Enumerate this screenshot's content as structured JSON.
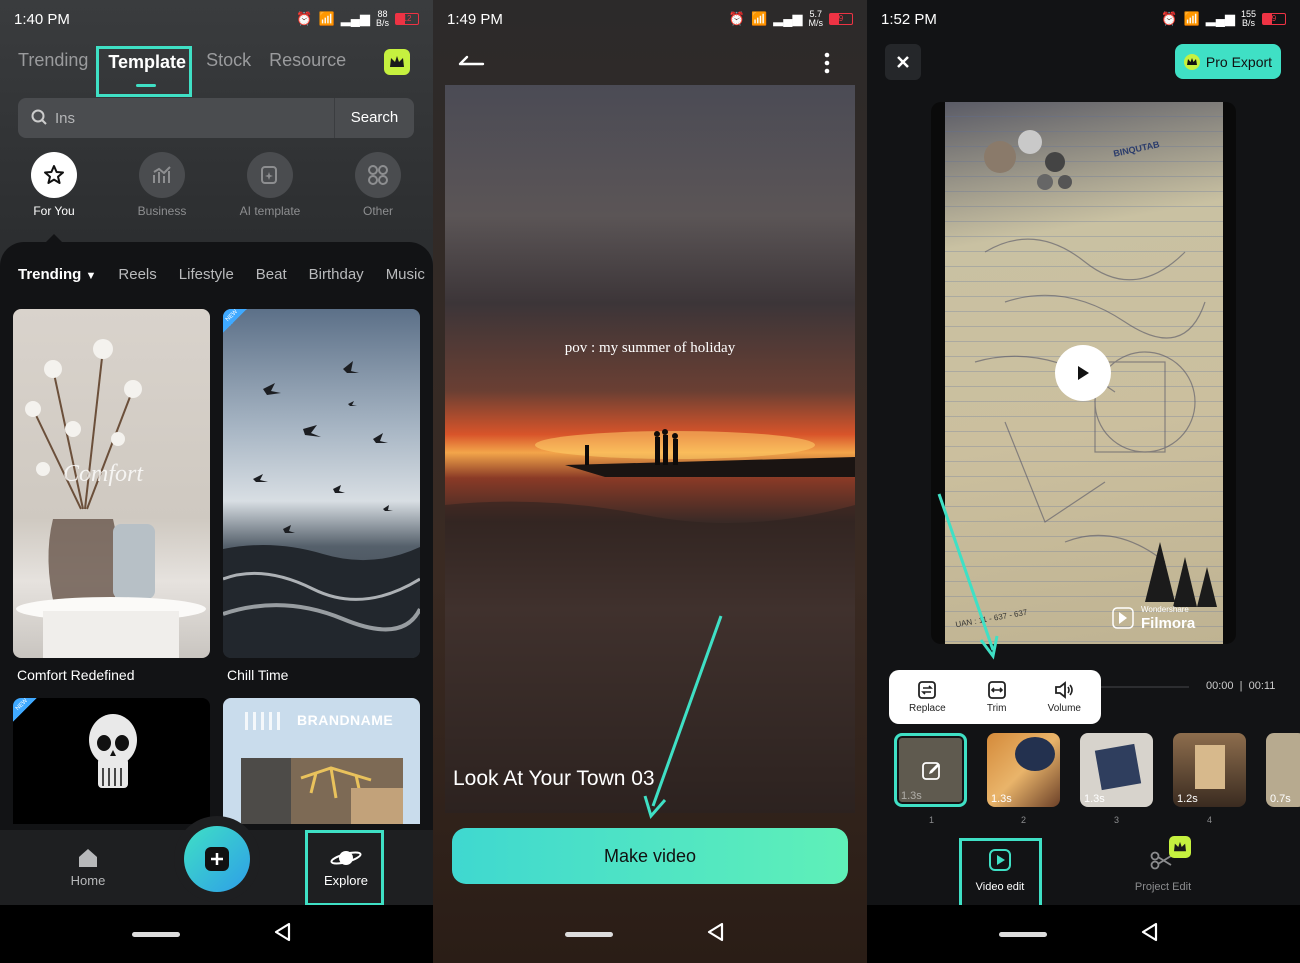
{
  "panel1": {
    "status": {
      "time": "1:40 PM",
      "speed_top": "88",
      "speed_bottom": "B/s",
      "battery": "12"
    },
    "tabs": [
      "Trending",
      "Template",
      "Stock",
      "Resource"
    ],
    "search": {
      "placeholder": "Ins",
      "button": "Search"
    },
    "categories": [
      {
        "label": "For You",
        "icon": "star-icon"
      },
      {
        "label": "Business",
        "icon": "chart-icon"
      },
      {
        "label": "AI template",
        "icon": "ai-template-icon"
      },
      {
        "label": "Other",
        "icon": "grid-icon"
      }
    ],
    "filters": [
      "Trending",
      "Reels",
      "Lifestyle",
      "Beat",
      "Birthday",
      "Music"
    ],
    "cards": [
      {
        "title": "Comfort Redefined",
        "overlay": "Comfort"
      },
      {
        "title": "Chill Time",
        "badge": "NEW"
      },
      {
        "title": "",
        "badge": "NEW"
      },
      {
        "title": "",
        "overlay": "BRANDNAME"
      }
    ],
    "bottom_nav": {
      "home": "Home",
      "explore": "Explore"
    }
  },
  "panel2": {
    "status": {
      "time": "1:49 PM",
      "speed_top": "5.7",
      "speed_bottom": "M/s",
      "battery": "9"
    },
    "overlay_text": "pov : my summer of holiday",
    "template_name": "Look At Your Town 03",
    "make_button": "Make video"
  },
  "panel3": {
    "status": {
      "time": "1:52 PM",
      "speed_top": "155",
      "speed_bottom": "B/s",
      "battery": "9"
    },
    "pro_export": "Pro Export",
    "watermark_top": "Wondershare",
    "watermark": "Filmora",
    "paper_brand": "BINQUTAB",
    "paper_code": "UAN : 11 - 637 - 637",
    "time_current": "00:00",
    "time_total": "00:11",
    "tools": [
      "Replace",
      "Trim",
      "Volume"
    ],
    "clips": [
      {
        "dur": "1.3s",
        "index": "1"
      },
      {
        "dur": "1.3s",
        "index": "2"
      },
      {
        "dur": "1.3s",
        "index": "3"
      },
      {
        "dur": "1.2s",
        "index": "4"
      },
      {
        "dur": "0.7s",
        "index": ""
      }
    ],
    "bottom": {
      "video_edit": "Video edit",
      "project_edit": "Project Edit"
    }
  },
  "colors": {
    "accent": "#3fe0c5",
    "crown": "#c6f13f"
  }
}
